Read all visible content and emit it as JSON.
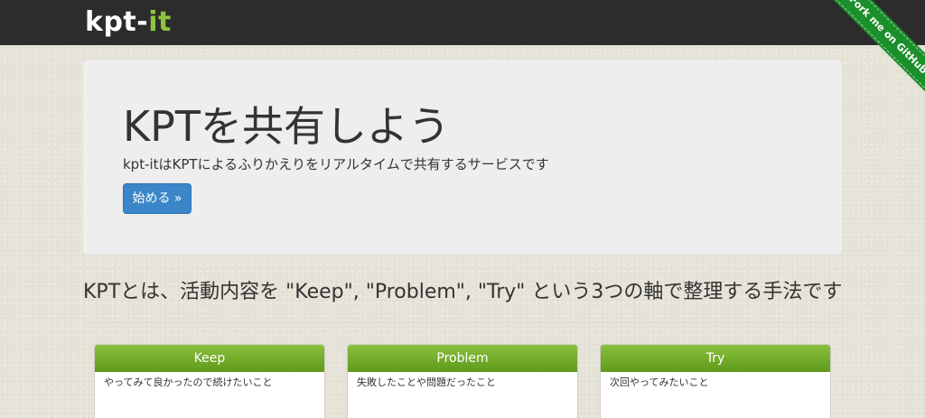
{
  "navbar": {
    "brand_main": "kpt-",
    "brand_accent": "it",
    "ribbon_label": "Fork me on GitHub"
  },
  "hero": {
    "title": "KPTを共有しよう",
    "subtitle": "kpt-itはKPTによるふりかえりをリアルタイムで共有するサービスです",
    "start_button": "始める »"
  },
  "intro": {
    "text": "KPTとは、活動内容を \"Keep\", \"Problem\", \"Try\" という3つの軸で整理する手法です"
  },
  "cards": [
    {
      "title": "Keep",
      "description": "やってみて良かったので続けたいこと"
    },
    {
      "title": "Problem",
      "description": "失敗したことや問題だったこと"
    },
    {
      "title": "Try",
      "description": "次回やってみたいこと"
    }
  ],
  "colors": {
    "navbar_bg": "#2c2c2c",
    "brand_accent": "#8cc43d",
    "button_primary": "#3a86c9",
    "card_header": "#6fa82a",
    "ribbon": "#1b8f2a"
  }
}
